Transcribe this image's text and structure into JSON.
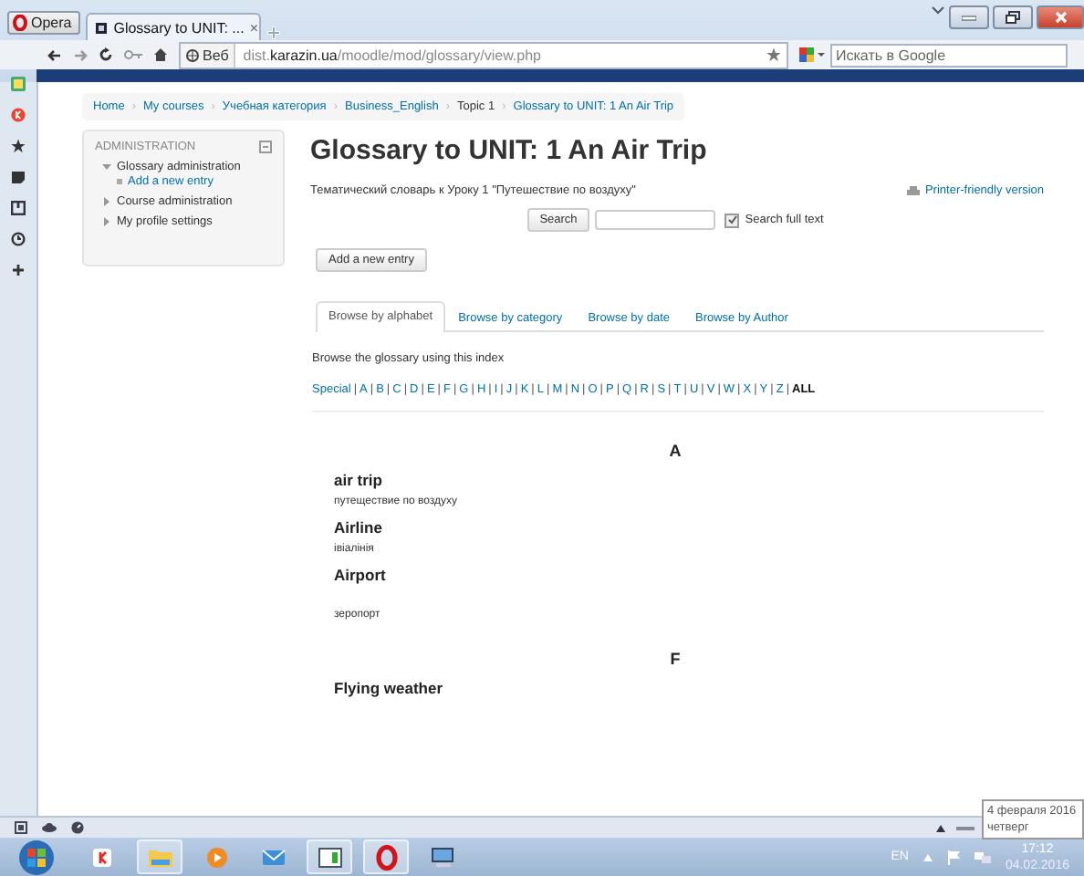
{
  "browser": {
    "menu_button": "Opera",
    "tab": {
      "title": "Glossary to UNIT: ...",
      "close": "×"
    },
    "address": {
      "badge": "Веб",
      "url": "dist.**karazin.ua**/moodle/mod/glossary/view.php"
    },
    "search": {
      "placeholder": "Искать в Google"
    }
  },
  "breadcrumb": {
    "separator": "›",
    "items": [
      {
        "label": "Home",
        "link": true
      },
      {
        "label": "My courses",
        "link": true
      },
      {
        "label": "Учебная категория",
        "link": true
      },
      {
        "label": "Business_English",
        "link": true
      },
      {
        "label": "Topic 1",
        "link": false
      },
      {
        "label": "Glossary to UNIT: 1 An Air Trip",
        "link": true
      }
    ]
  },
  "admin_block": {
    "title": "ADMINISTRATION",
    "items": [
      {
        "label": "Glossary administration",
        "expanded": true,
        "children": [
          {
            "label": "Add a new entry"
          }
        ]
      },
      {
        "label": "Course administration",
        "expanded": false
      },
      {
        "label": "My profile settings",
        "expanded": false
      }
    ]
  },
  "glossary": {
    "title": "Glossary to UNIT: 1 An Air Trip",
    "description": "Тематический словарь к Уроку 1 \"Путешествие по воздуху\"",
    "printer_link": "Printer-friendly version",
    "search_button": "Search",
    "search_full_text": {
      "label": "Search full text",
      "checked": true
    },
    "add_button": "Add a new entry",
    "tabs": [
      {
        "label": "Browse by alphabet",
        "selected": true
      },
      {
        "label": "Browse by category",
        "selected": false
      },
      {
        "label": "Browse by date",
        "selected": false
      },
      {
        "label": "Browse by Author",
        "selected": false
      }
    ],
    "browse_hint": "Browse the glossary using this index",
    "letter_separator": "|",
    "letters": [
      {
        "label": "Special",
        "selected": false
      },
      {
        "label": "A",
        "selected": false
      },
      {
        "label": "B",
        "selected": false
      },
      {
        "label": "C",
        "selected": false
      },
      {
        "label": "D",
        "selected": false
      },
      {
        "label": "E",
        "selected": false
      },
      {
        "label": "F",
        "selected": false
      },
      {
        "label": "G",
        "selected": false
      },
      {
        "label": "H",
        "selected": false
      },
      {
        "label": "I",
        "selected": false
      },
      {
        "label": "J",
        "selected": false
      },
      {
        "label": "K",
        "selected": false
      },
      {
        "label": "L",
        "selected": false
      },
      {
        "label": "M",
        "selected": false
      },
      {
        "label": "N",
        "selected": false
      },
      {
        "label": "O",
        "selected": false
      },
      {
        "label": "P",
        "selected": false
      },
      {
        "label": "Q",
        "selected": false
      },
      {
        "label": "R",
        "selected": false
      },
      {
        "label": "S",
        "selected": false
      },
      {
        "label": "T",
        "selected": false
      },
      {
        "label": "U",
        "selected": false
      },
      {
        "label": "V",
        "selected": false
      },
      {
        "label": "W",
        "selected": false
      },
      {
        "label": "X",
        "selected": false
      },
      {
        "label": "Y",
        "selected": false
      },
      {
        "label": "Z",
        "selected": false
      },
      {
        "label": "ALL",
        "selected": true
      }
    ],
    "groups": [
      {
        "letter": "A",
        "entries": [
          {
            "term": "air trip",
            "definition": "путеществие по воздуху"
          },
          {
            "term": "Airline",
            "definition": "івіалінія"
          },
          {
            "term": "Airport",
            "definition": "зеропорт"
          }
        ]
      },
      {
        "letter": "F",
        "entries": [
          {
            "term": "Flying weather"
          }
        ]
      }
    ]
  },
  "taskbar": {
    "language": "EN",
    "time": "17:12",
    "date": "04.02.2016"
  },
  "tooltip": {
    "date": "4 февраля 2016",
    "weekday": "четверг"
  }
}
